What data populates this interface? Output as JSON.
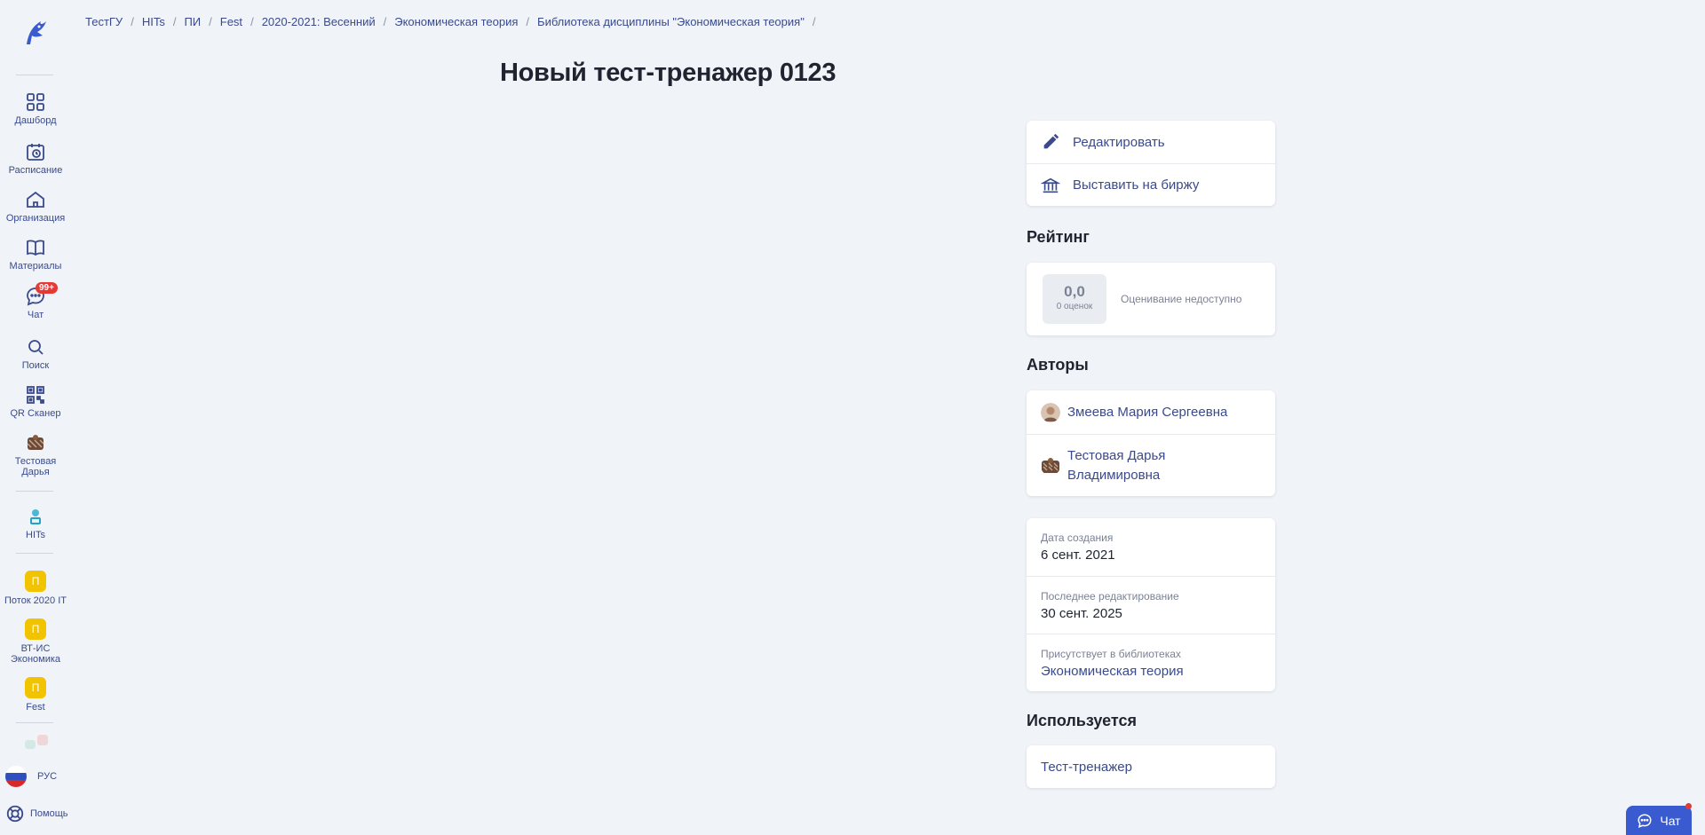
{
  "sidebar": {
    "items": [
      {
        "label": "Дашборд",
        "icon": "grid-icon"
      },
      {
        "label": "Расписание",
        "icon": "calendar-icon"
      },
      {
        "label": "Организация",
        "icon": "home-icon"
      },
      {
        "label": "Материалы",
        "icon": "book-icon"
      },
      {
        "label": "Чат",
        "icon": "chat-icon",
        "badge": "99+"
      },
      {
        "label": "Поиск",
        "icon": "search-icon"
      },
      {
        "label": "QR Сканер",
        "icon": "qr-icon"
      },
      {
        "label": "Тестовая Дарья",
        "icon": "avatar-icon"
      },
      {
        "label": "HITs",
        "icon": "hits-icon"
      },
      {
        "label": "Поток 2020 IT",
        "letter": "П"
      },
      {
        "label": "ВТ-ИС Экономика",
        "letter": "П"
      },
      {
        "label": "Fest",
        "letter": "П"
      }
    ],
    "language": "РУС",
    "help": "Помощь"
  },
  "breadcrumbs": [
    "ТестГУ",
    "HITs",
    "ПИ",
    "Fest",
    "2020-2021: Весенний",
    "Экономическая теория",
    "Библиотека дисциплины \"Экономическая теория\""
  ],
  "page_title": "Новый тест-тренажер 0123",
  "actions": {
    "edit": "Редактировать",
    "publish": "Выставить на биржу"
  },
  "rating": {
    "title": "Рейтинг",
    "score": "0,0",
    "count": "0 оценок",
    "note": "Оценивание недоступно"
  },
  "authors": {
    "title": "Авторы",
    "list": [
      "Змеева Мария Сергеевна",
      "Тестовая Дарья Владимировна"
    ]
  },
  "info": {
    "created_label": "Дата создания",
    "created": "6 сент. 2021",
    "edited_label": "Последнее редактирование",
    "edited": "30 сент. 2025",
    "libraries_label": "Присутствует в библиотеках",
    "libraries": "Экономическая теория"
  },
  "usage": {
    "title": "Используется",
    "item": "Тест-тренажер"
  },
  "chat_button": "Чат",
  "colors": {
    "accent": "#3a4a8c",
    "background": "#f0f4f8",
    "badge": "#e53935",
    "org": "#f2c300",
    "chat": "#3a5bd0"
  }
}
